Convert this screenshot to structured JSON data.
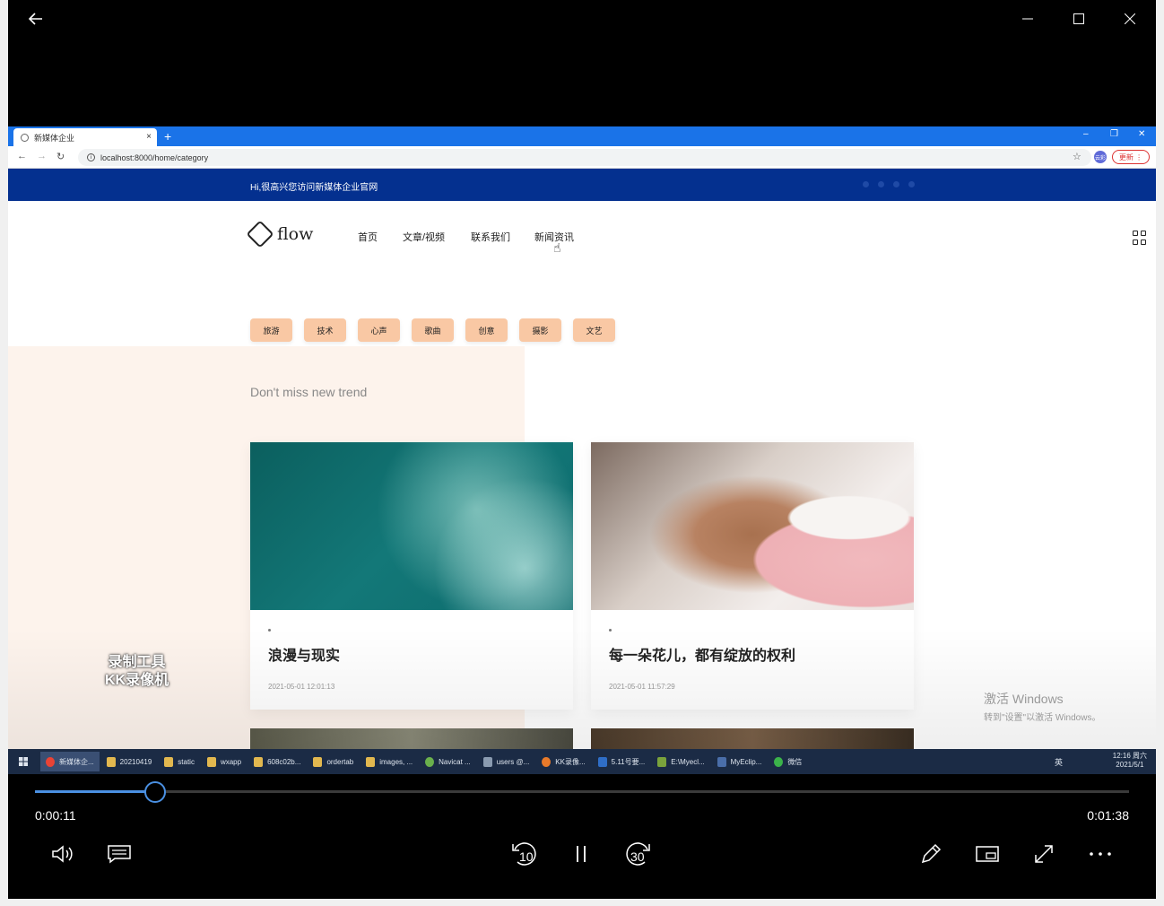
{
  "player": {
    "back_icon": "arrow-left-icon",
    "minimize_icon": "minimize-icon",
    "maximize_icon": "maximize-icon",
    "close_icon": "close-icon",
    "current_time": "0:00:11",
    "total_time": "0:01:38",
    "progress": 0.11,
    "skip_back_label": "10",
    "skip_forward_label": "30"
  },
  "browser": {
    "tab_title": "新媒体企业",
    "tab_close": "×",
    "new_tab": "+",
    "url": "localhost:8000/home/category",
    "avatar_text": "云彩",
    "update_label": "更新 ⋮",
    "accent": "#1a73e8"
  },
  "site": {
    "welcome": "Hi,很高兴您访问新媒体企业官网",
    "logo_text": "flow",
    "menu": [
      "首页",
      "文章/视频",
      "联系我们",
      "新闻资讯"
    ],
    "categories": [
      "旅游",
      "技术",
      "心声",
      "歌曲",
      "创意",
      "摄影",
      "文艺"
    ],
    "trend_heading": "Don't miss new trend",
    "cards": [
      {
        "title": "浪漫与现实",
        "date": "2021-05-01 12:01:13"
      },
      {
        "title": "每一朵花儿，都有绽放的权利",
        "date": "2021-05-01 11:57:29"
      }
    ],
    "top_color": "#04308f",
    "category_color": "#f9c8a4"
  },
  "overlay": {
    "watermark_line1": "录制工具",
    "watermark_line2": "KK录像机",
    "activate_line1": "激活 Windows",
    "activate_line2": "转到\"设置\"以激活 Windows。"
  },
  "taskbar": {
    "items": [
      "新媒体企...",
      "20210419",
      "static",
      "wxapp",
      "608c02b...",
      "ordertab",
      "images, ...",
      "Navicat ...",
      "users @...",
      "KK录像...",
      "5.11号要...",
      "E:\\Myecl...",
      "MyEclip...",
      "微信"
    ],
    "tray_lang": "英",
    "clock_time": "12:16 周六",
    "clock_date": "2021/5/1"
  }
}
